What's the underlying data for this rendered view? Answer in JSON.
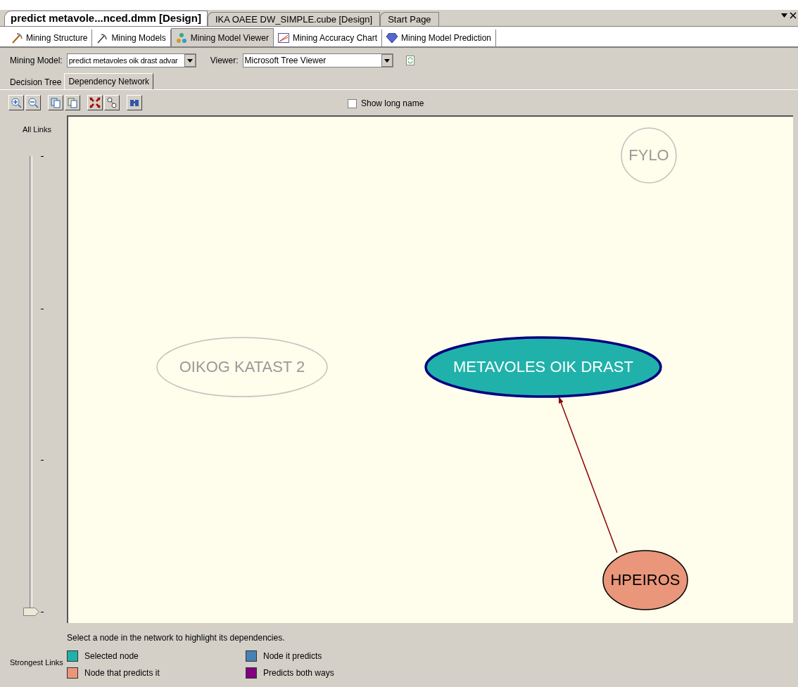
{
  "document_tabs": [
    {
      "label": "predict metavole...nced.dmm [Design]",
      "selected": true
    },
    {
      "label": "IKA OAEE DW_SIMPLE.cube [Design]",
      "selected": false
    },
    {
      "label": "Start Page",
      "selected": false
    }
  ],
  "designer_tabs": [
    {
      "label": "Mining Structure",
      "selected": false
    },
    {
      "label": "Mining Models",
      "selected": false
    },
    {
      "label": "Mining Model Viewer",
      "selected": true
    },
    {
      "label": "Mining Accuracy Chart",
      "selected": false
    },
    {
      "label": "Mining Model Prediction",
      "selected": false
    }
  ],
  "mining_model": {
    "label": "Mining Model:",
    "value": "predict metavoles oik drast advar"
  },
  "viewer": {
    "label": "Viewer:",
    "value": "Microsoft Tree Viewer"
  },
  "viewer_tabs": [
    {
      "label": "Decision Tree",
      "selected": false
    },
    {
      "label": "Dependency Network",
      "selected": true
    }
  ],
  "show_long_name": {
    "label": "Show long name",
    "checked": false
  },
  "link_slider": {
    "top_label": "All Links",
    "bottom_label": "Strongest Links",
    "level": 0
  },
  "network": {
    "nodes": [
      {
        "label": "FYLO",
        "kind": "unrelated"
      },
      {
        "label": "OIKOG KATAST 2",
        "kind": "unrelated"
      },
      {
        "label": "METAVOLES OIK DRAST",
        "kind": "selected"
      },
      {
        "label": "HPEIROS",
        "kind": "predictor"
      }
    ]
  },
  "hint": "Select a node in the network to highlight its dependencies.",
  "legend": [
    {
      "label": "Selected node",
      "color": "#20b2aa"
    },
    {
      "label": "Node it predicts",
      "color": "#4682b4"
    },
    {
      "label": "Node that predicts it",
      "color": "#e9967a"
    },
    {
      "label": "Predicts both ways",
      "color": "#800080"
    }
  ]
}
